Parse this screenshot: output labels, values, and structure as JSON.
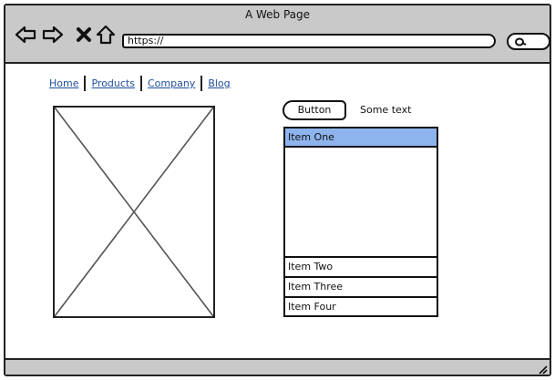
{
  "window": {
    "title": "A Web Page"
  },
  "toolbar": {
    "back_icon": "back-arrow-icon",
    "forward_icon": "forward-arrow-icon",
    "close_icon": "close-icon",
    "home_icon": "home-icon",
    "url": "https://",
    "search_icon": "search-icon"
  },
  "nav": {
    "links": [
      {
        "label": "Home"
      },
      {
        "label": "Products"
      },
      {
        "label": "Company"
      },
      {
        "label": "Blog"
      }
    ]
  },
  "content": {
    "button_label": "Button",
    "some_text": "Some text",
    "list": {
      "selected_item": "Item One",
      "items": [
        "Item One",
        "Item Two",
        "Item Three",
        "Item Four"
      ]
    }
  },
  "colors": {
    "chrome": "#c9c9c9",
    "link": "#1f4e9a",
    "selection": "#8eb4ee"
  }
}
